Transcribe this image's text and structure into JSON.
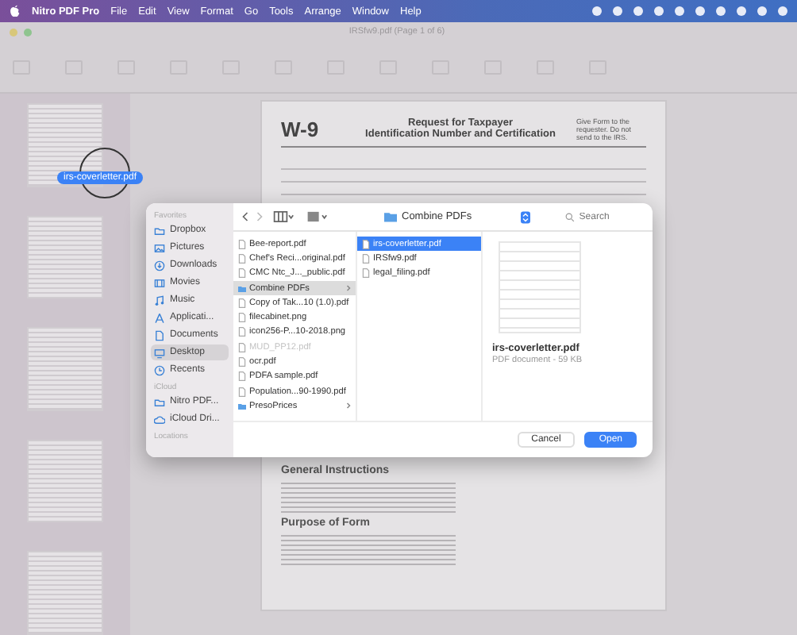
{
  "menu_bar": {
    "app": "Nitro PDF Pro",
    "items": [
      "File",
      "Edit",
      "View",
      "Format",
      "Go",
      "Tools",
      "Arrange",
      "Window",
      "Help"
    ]
  },
  "window": {
    "title": "IRSfw9.pdf (Page 1 of 6)"
  },
  "document": {
    "form": "W-9",
    "title": "Request for Taxpayer",
    "subtitle": "Identification Number and Certification",
    "note": "Give Form to the requester. Do not send to the IRS.",
    "headings": [
      "General Instructions",
      "Purpose of Form"
    ]
  },
  "drag_label": "irs-coverletter.pdf",
  "dialog": {
    "path": "Combine PDFs",
    "search": {
      "placeholder": "Search"
    },
    "sidebar": [
      {
        "heading": "Favorites",
        "items": [
          {
            "label": "Dropbox",
            "kind": "folder",
            "selected": false
          },
          {
            "label": "Pictures",
            "kind": "picture",
            "selected": false
          },
          {
            "label": "Downloads",
            "kind": "download",
            "selected": false
          },
          {
            "label": "Movies",
            "kind": "film",
            "selected": false
          },
          {
            "label": "Music",
            "kind": "note",
            "selected": false
          },
          {
            "label": "Applicati...",
            "kind": "apps",
            "selected": false
          },
          {
            "label": "Documents",
            "kind": "doc",
            "selected": false
          },
          {
            "label": "Desktop",
            "kind": "desktop",
            "selected": true
          },
          {
            "label": "Recents",
            "kind": "clock",
            "selected": false
          }
        ]
      },
      {
        "heading": "iCloud",
        "items": [
          {
            "label": "Nitro PDF...",
            "kind": "folder",
            "selected": false
          },
          {
            "label": "iCloud Dri...",
            "kind": "cloud",
            "selected": false
          }
        ]
      },
      {
        "heading": "Locations"
      }
    ],
    "column_1": [
      {
        "name": "Bee-report.pdf",
        "kind": "file",
        "selected": false,
        "disabled": false
      },
      {
        "name": "Chef's Reci...original.pdf",
        "kind": "file",
        "selected": false,
        "disabled": false
      },
      {
        "name": "CMC Ntc_J..._public.pdf",
        "kind": "file",
        "selected": false,
        "disabled": false
      },
      {
        "name": "Combine PDFs",
        "kind": "folder",
        "selected": true,
        "disabled": false
      },
      {
        "name": "Copy of Tak...10 (1.0).pdf",
        "kind": "file",
        "selected": false,
        "disabled": false
      },
      {
        "name": "filecabinet.png",
        "kind": "file",
        "selected": false,
        "disabled": false
      },
      {
        "name": "icon256-P...10-2018.png",
        "kind": "file",
        "selected": false,
        "disabled": false
      },
      {
        "name": "MUD_PP12.pdf",
        "kind": "file",
        "selected": false,
        "disabled": true
      },
      {
        "name": "ocr.pdf",
        "kind": "file",
        "selected": false,
        "disabled": false
      },
      {
        "name": "PDFA sample.pdf",
        "kind": "file",
        "selected": false,
        "disabled": false
      },
      {
        "name": "Population...90-1990.pdf",
        "kind": "file",
        "selected": false,
        "disabled": false
      },
      {
        "name": "PresoPrices",
        "kind": "folder",
        "selected": false,
        "disabled": false
      }
    ],
    "column_2": [
      {
        "name": "irs-coverletter.pdf",
        "kind": "file",
        "selected": true,
        "disabled": false
      },
      {
        "name": "IRSfw9.pdf",
        "kind": "file",
        "selected": false,
        "disabled": false
      },
      {
        "name": "legal_filing.pdf",
        "kind": "file",
        "selected": false,
        "disabled": false
      }
    ],
    "preview": {
      "name": "irs-coverletter.pdf",
      "info": "PDF document - 59 KB"
    },
    "buttons": [
      {
        "label": "Cancel",
        "kind": "secondary"
      },
      {
        "label": "Open",
        "kind": "primary"
      }
    ]
  }
}
